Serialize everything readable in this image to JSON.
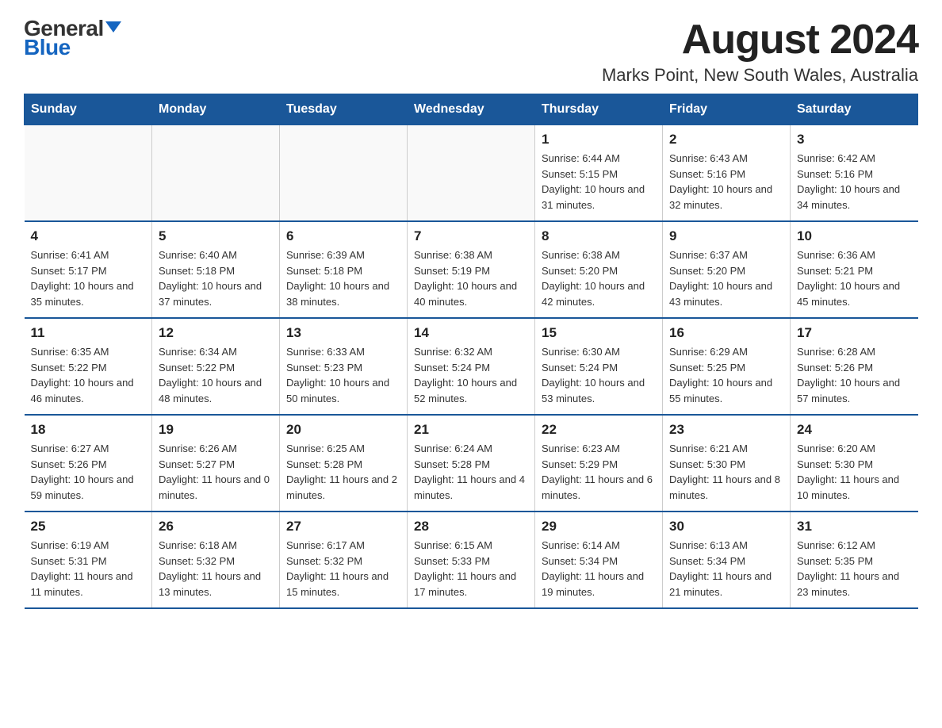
{
  "header": {
    "logo_general": "General",
    "logo_blue": "Blue",
    "month_title": "August 2024",
    "location": "Marks Point, New South Wales, Australia"
  },
  "days_of_week": [
    "Sunday",
    "Monday",
    "Tuesday",
    "Wednesday",
    "Thursday",
    "Friday",
    "Saturday"
  ],
  "weeks": [
    [
      {
        "day": "",
        "info": ""
      },
      {
        "day": "",
        "info": ""
      },
      {
        "day": "",
        "info": ""
      },
      {
        "day": "",
        "info": ""
      },
      {
        "day": "1",
        "info": "Sunrise: 6:44 AM\nSunset: 5:15 PM\nDaylight: 10 hours and 31 minutes."
      },
      {
        "day": "2",
        "info": "Sunrise: 6:43 AM\nSunset: 5:16 PM\nDaylight: 10 hours and 32 minutes."
      },
      {
        "day": "3",
        "info": "Sunrise: 6:42 AM\nSunset: 5:16 PM\nDaylight: 10 hours and 34 minutes."
      }
    ],
    [
      {
        "day": "4",
        "info": "Sunrise: 6:41 AM\nSunset: 5:17 PM\nDaylight: 10 hours and 35 minutes."
      },
      {
        "day": "5",
        "info": "Sunrise: 6:40 AM\nSunset: 5:18 PM\nDaylight: 10 hours and 37 minutes."
      },
      {
        "day": "6",
        "info": "Sunrise: 6:39 AM\nSunset: 5:18 PM\nDaylight: 10 hours and 38 minutes."
      },
      {
        "day": "7",
        "info": "Sunrise: 6:38 AM\nSunset: 5:19 PM\nDaylight: 10 hours and 40 minutes."
      },
      {
        "day": "8",
        "info": "Sunrise: 6:38 AM\nSunset: 5:20 PM\nDaylight: 10 hours and 42 minutes."
      },
      {
        "day": "9",
        "info": "Sunrise: 6:37 AM\nSunset: 5:20 PM\nDaylight: 10 hours and 43 minutes."
      },
      {
        "day": "10",
        "info": "Sunrise: 6:36 AM\nSunset: 5:21 PM\nDaylight: 10 hours and 45 minutes."
      }
    ],
    [
      {
        "day": "11",
        "info": "Sunrise: 6:35 AM\nSunset: 5:22 PM\nDaylight: 10 hours and 46 minutes."
      },
      {
        "day": "12",
        "info": "Sunrise: 6:34 AM\nSunset: 5:22 PM\nDaylight: 10 hours and 48 minutes."
      },
      {
        "day": "13",
        "info": "Sunrise: 6:33 AM\nSunset: 5:23 PM\nDaylight: 10 hours and 50 minutes."
      },
      {
        "day": "14",
        "info": "Sunrise: 6:32 AM\nSunset: 5:24 PM\nDaylight: 10 hours and 52 minutes."
      },
      {
        "day": "15",
        "info": "Sunrise: 6:30 AM\nSunset: 5:24 PM\nDaylight: 10 hours and 53 minutes."
      },
      {
        "day": "16",
        "info": "Sunrise: 6:29 AM\nSunset: 5:25 PM\nDaylight: 10 hours and 55 minutes."
      },
      {
        "day": "17",
        "info": "Sunrise: 6:28 AM\nSunset: 5:26 PM\nDaylight: 10 hours and 57 minutes."
      }
    ],
    [
      {
        "day": "18",
        "info": "Sunrise: 6:27 AM\nSunset: 5:26 PM\nDaylight: 10 hours and 59 minutes."
      },
      {
        "day": "19",
        "info": "Sunrise: 6:26 AM\nSunset: 5:27 PM\nDaylight: 11 hours and 0 minutes."
      },
      {
        "day": "20",
        "info": "Sunrise: 6:25 AM\nSunset: 5:28 PM\nDaylight: 11 hours and 2 minutes."
      },
      {
        "day": "21",
        "info": "Sunrise: 6:24 AM\nSunset: 5:28 PM\nDaylight: 11 hours and 4 minutes."
      },
      {
        "day": "22",
        "info": "Sunrise: 6:23 AM\nSunset: 5:29 PM\nDaylight: 11 hours and 6 minutes."
      },
      {
        "day": "23",
        "info": "Sunrise: 6:21 AM\nSunset: 5:30 PM\nDaylight: 11 hours and 8 minutes."
      },
      {
        "day": "24",
        "info": "Sunrise: 6:20 AM\nSunset: 5:30 PM\nDaylight: 11 hours and 10 minutes."
      }
    ],
    [
      {
        "day": "25",
        "info": "Sunrise: 6:19 AM\nSunset: 5:31 PM\nDaylight: 11 hours and 11 minutes."
      },
      {
        "day": "26",
        "info": "Sunrise: 6:18 AM\nSunset: 5:32 PM\nDaylight: 11 hours and 13 minutes."
      },
      {
        "day": "27",
        "info": "Sunrise: 6:17 AM\nSunset: 5:32 PM\nDaylight: 11 hours and 15 minutes."
      },
      {
        "day": "28",
        "info": "Sunrise: 6:15 AM\nSunset: 5:33 PM\nDaylight: 11 hours and 17 minutes."
      },
      {
        "day": "29",
        "info": "Sunrise: 6:14 AM\nSunset: 5:34 PM\nDaylight: 11 hours and 19 minutes."
      },
      {
        "day": "30",
        "info": "Sunrise: 6:13 AM\nSunset: 5:34 PM\nDaylight: 11 hours and 21 minutes."
      },
      {
        "day": "31",
        "info": "Sunrise: 6:12 AM\nSunset: 5:35 PM\nDaylight: 11 hours and 23 minutes."
      }
    ]
  ]
}
